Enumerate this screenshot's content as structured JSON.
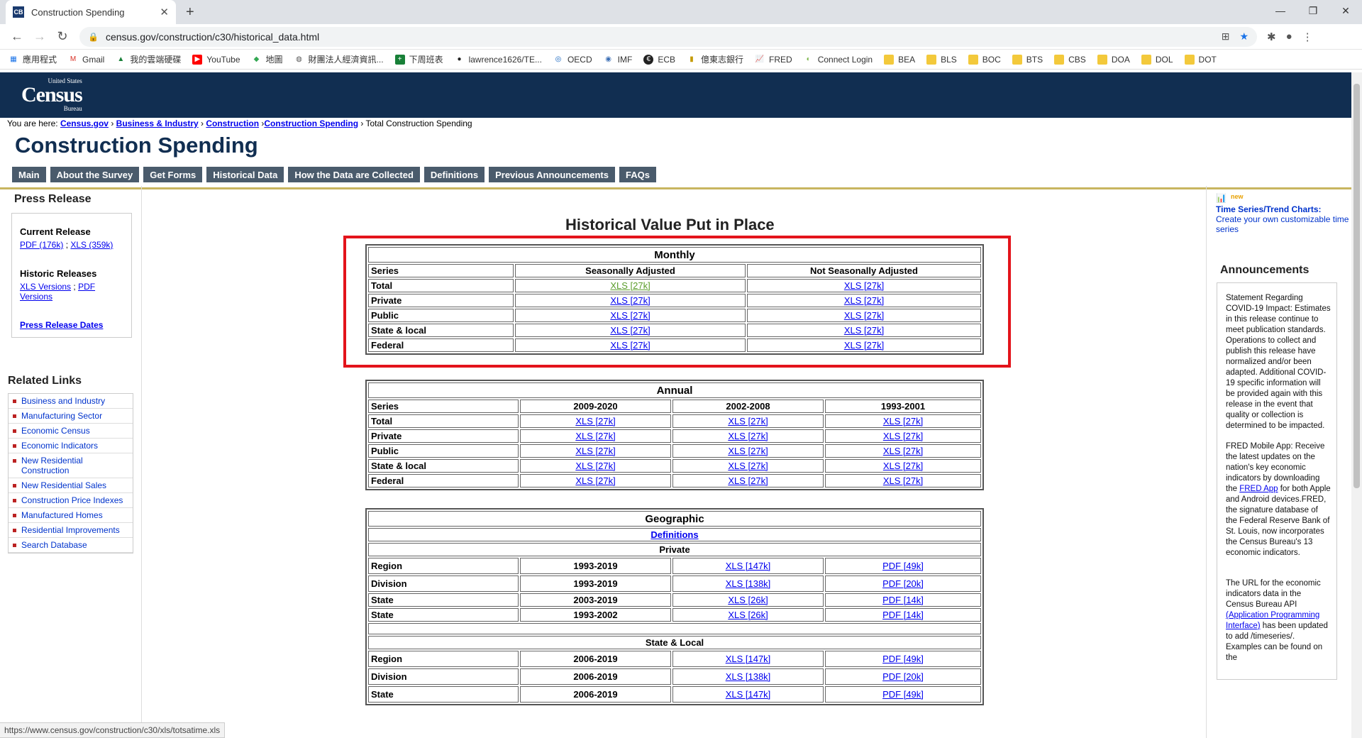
{
  "browser": {
    "tab_title": "Construction Spending",
    "favicon_text": "CB",
    "url": "census.gov/construction/c30/historical_data.html",
    "bookmarks": [
      "應用程式",
      "Gmail",
      "我的雲端硬碟",
      "YouTube",
      "地圖",
      "財團法人經濟資訊...",
      "下周班表",
      "lawrence1626/TE...",
      "OECD",
      "IMF",
      "ECB",
      "億東志銀行",
      "FRED",
      "Connect Login",
      "BEA",
      "BLS",
      "BOC",
      "BTS",
      "CBS",
      "DOA",
      "DOL",
      "DOT"
    ]
  },
  "site": {
    "logo_small": "United States",
    "logo_big": "Census",
    "logo_sub": "Bureau",
    "breadcrumb_prefix": "You are here:",
    "breadcrumb_links": [
      "Census.gov",
      "Business & Industry",
      "Construction",
      "Construction Spending"
    ],
    "breadcrumb_current": "Total Construction Spending",
    "page_title": "Construction Spending",
    "nav_tabs": [
      "Main",
      "About the Survey",
      "Get Forms",
      "Historical Data",
      "How the Data are Collected",
      "Definitions",
      "Previous Announcements",
      "FAQs"
    ]
  },
  "left": {
    "press_release_heading": "Press Release",
    "current_release_heading": "Current Release",
    "current_pdf": "PDF (176k)",
    "current_xls": "XLS (359k)",
    "historic_heading": "Historic Releases",
    "historic_xls": "XLS Versions",
    "historic_pdf": "PDF Versions",
    "press_dates": "Press Release Dates",
    "related_heading": "Related Links",
    "related_links": [
      "Business and Industry",
      "Manufacturing Sector",
      "Economic Census",
      "Economic Indicators",
      "New Residential Construction",
      "New Residential Sales",
      "Construction Price Indexes",
      "Manufactured Homes",
      "Residential Improvements",
      "Search Database"
    ]
  },
  "main": {
    "heading": "Historical Value Put in Place",
    "monthly": {
      "caption": "Monthly",
      "headers": [
        "Series",
        "Seasonally Adjusted",
        "Not Seasonally Adjusted"
      ],
      "rows": [
        {
          "label": "Total",
          "sa": "XLS [27k]",
          "nsa": "XLS [27k]"
        },
        {
          "label": "Private",
          "sa": "XLS [27k]",
          "nsa": "XLS [27k]"
        },
        {
          "label": "Public",
          "sa": "XLS [27k]",
          "nsa": "XLS [27k]"
        },
        {
          "label": "State & local",
          "sa": "XLS [27k]",
          "nsa": "XLS [27k]"
        },
        {
          "label": "Federal",
          "sa": "XLS [27k]",
          "nsa": "XLS [27k]"
        }
      ]
    },
    "annual": {
      "caption": "Annual",
      "headers": [
        "Series",
        "2009-2020",
        "2002-2008",
        "1993-2001"
      ],
      "rows": [
        {
          "label": "Total",
          "a": "XLS [27k]",
          "b": "XLS [27k]",
          "c": "XLS [27k]"
        },
        {
          "label": "Private",
          "a": "XLS [27k]",
          "b": "XLS [27k]",
          "c": "XLS [27k]"
        },
        {
          "label": "Public",
          "a": "XLS [27k]",
          "b": "XLS [27k]",
          "c": "XLS [27k]"
        },
        {
          "label": "State & local",
          "a": "XLS [27k]",
          "b": "XLS [27k]",
          "c": "XLS [27k]"
        },
        {
          "label": "Federal",
          "a": "XLS [27k]",
          "b": "XLS [27k]",
          "c": "XLS [27k]"
        }
      ]
    },
    "geographic": {
      "caption": "Geographic",
      "definitions": "Definitions",
      "private_heading": "Private",
      "private_rows": [
        {
          "label": "Region",
          "years": "1993-2019",
          "xls": "XLS [147k]",
          "pdf": "PDF [49k]"
        },
        {
          "label": "Division",
          "years": "1993-2019",
          "xls": "XLS [138k]",
          "pdf": "PDF [20k]"
        },
        {
          "label": "State",
          "years": "2003-2019",
          "xls": "XLS [26k]",
          "pdf": "PDF [14k]"
        },
        {
          "label": "State",
          "years": "1993-2002",
          "xls": "XLS [26k]",
          "pdf": "PDF [14k]"
        }
      ],
      "state_local_heading": "State & Local",
      "state_local_rows": [
        {
          "label": "Region",
          "years": "2006-2019",
          "xls": "XLS [147k]",
          "pdf": "PDF [49k]"
        },
        {
          "label": "Division",
          "years": "2006-2019",
          "xls": "XLS [138k]",
          "pdf": "PDF [20k]"
        },
        {
          "label": "State",
          "years": "2006-2019",
          "xls": "XLS [147k]",
          "pdf": "PDF [49k]"
        }
      ]
    }
  },
  "right": {
    "ts_title": "Time Series/Trend Charts:",
    "ts_sub": "Create your own customizable time series",
    "new_badge": "new",
    "ann_heading": "Announcements",
    "ann1": "Statement Regarding COVID-19 Impact: Estimates in this release continue to meet publication standards. Operations to collect and publish this release have normalized and/or been adapted. Additional COVID-19 specific information will be provided again with this release in the event that quality or collection is determined to be impacted.",
    "ann2_pre": "FRED Mobile App: Receive the latest updates on the nation's key economic indicators by downloading the",
    "ann2_link": "FRED App",
    "ann2_post": "for both Apple and Android devices.FRED, the signature database of the Federal Reserve Bank of St. Louis, now incorporates the Census Bureau's 13 economic indicators.",
    "ann3_pre": "The URL for the economic indicators data in the Census Bureau API",
    "ann3_link": "(Application Programming Interface)",
    "ann3_post": "has been updated to add /timeseries/. Examples can be found on the"
  },
  "status_url": "https://www.census.gov/construction/c30/xls/totsatime.xls",
  "colors": {
    "banner": "#112e51",
    "tab_bg": "#4a5b6c",
    "gold_rule": "#c8b560",
    "highlight": "#e3141b"
  }
}
